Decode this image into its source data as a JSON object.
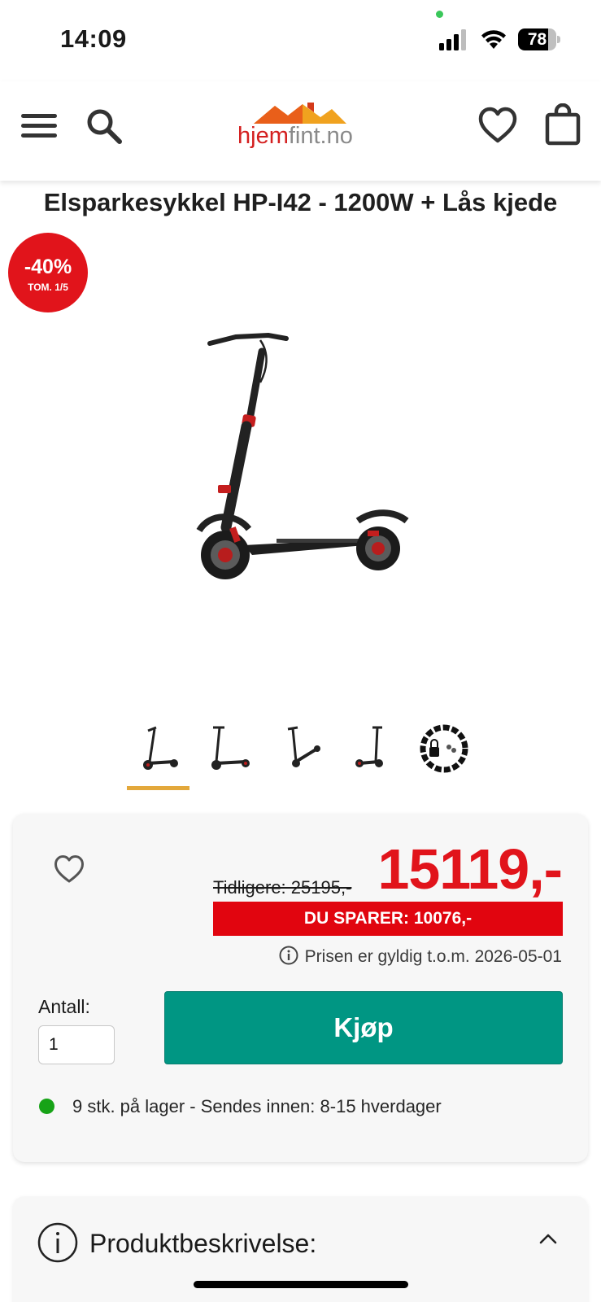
{
  "status_bar": {
    "time": "14:09",
    "battery": "78",
    "battery_level": 0.78
  },
  "header": {
    "logo_part1": "hjem",
    "logo_part2": "fint.no",
    "icons": [
      "menu-icon",
      "search-icon",
      "heart-icon",
      "shopping-bag-icon"
    ]
  },
  "product": {
    "title": "Elsparkesykkel HP-I42 - 1200W + Lås kjede",
    "badge_percent": "-40%",
    "badge_sub": "TOM. 1/5",
    "thumbnails": [
      "scooter-front",
      "scooter-side",
      "scooter-folded",
      "scooter-angle",
      "lock-chain"
    ],
    "active_thumbnail": 0
  },
  "pricing": {
    "old_price": "Tidligere: 25195,-",
    "new_price": "15119,-",
    "savings": "DU SPARER: 10076,-",
    "validity": "Prisen er gyldig t.o.m. 2026-05-01"
  },
  "purchase": {
    "quantity_label": "Antall:",
    "quantity_value": "1",
    "buy_label": "Kjøp"
  },
  "stock": {
    "text": "9 stk. på lager - Sendes innen: 8-15 hverdager",
    "status_color": "#17a317"
  },
  "description": {
    "title": "Produktbeskrivelse:"
  },
  "colors": {
    "brand_red": "#e1141b",
    "buy_green": "#009683",
    "thumb_indicator": "#e3a83b"
  }
}
